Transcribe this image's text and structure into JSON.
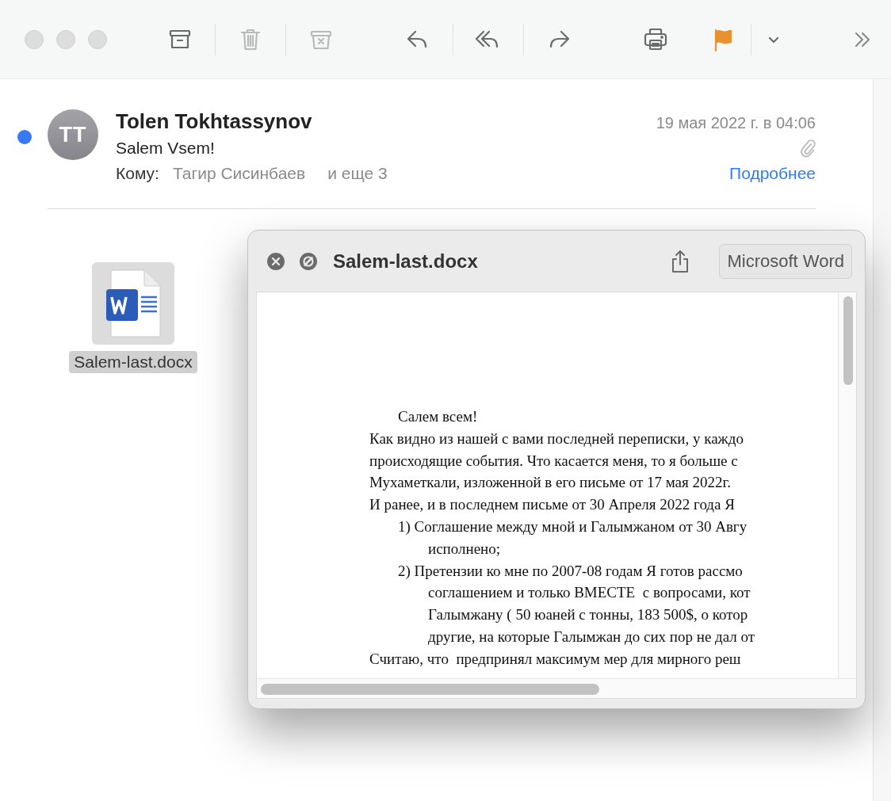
{
  "toolbar_groups": [
    {
      "items": [
        {
          "kind": "archive",
          "disabled": false
        }
      ]
    },
    {
      "items": [
        {
          "kind": "trash",
          "disabled": true
        }
      ]
    },
    {
      "items": [
        {
          "kind": "junk",
          "disabled": true
        },
        {
          "kind": "reply",
          "disabled": false
        }
      ]
    },
    {
      "items": [
        {
          "kind": "reply_all",
          "disabled": false
        }
      ]
    },
    {
      "items": [
        {
          "kind": "forward",
          "disabled": false
        },
        {
          "kind": "print",
          "disabled": false
        },
        {
          "kind": "flag",
          "disabled": false
        }
      ]
    },
    {
      "items": [
        {
          "kind": "menu",
          "disabled": false
        },
        {
          "kind": "more",
          "disabled": false
        }
      ]
    }
  ],
  "message": {
    "unread": true,
    "avatar_initials": "TT",
    "sender": "Tolen Tokhtassynov",
    "date": "19 мая 2022 г. в 04:06",
    "subject": "Salem Vsem!",
    "has_attachment": true,
    "to_label": "Кому:",
    "recipient": "Тагир Сисинбаев",
    "more_recipients": "и еще 3",
    "details_link": "Подробнее"
  },
  "attachment": {
    "name": "Salem-last.docx",
    "selected": true
  },
  "quicklook": {
    "title": "Salem-last.docx",
    "open_with": "Microsoft Word",
    "document_lines": [
      {
        "kind": "first",
        "text": "Салем всем!"
      },
      {
        "kind": "body",
        "text": "Как видно из нашей с вами последней переписки, у каждо"
      },
      {
        "kind": "body",
        "text": "происходящие события. Что касается меня, то я больше с"
      },
      {
        "kind": "body",
        "text": "Мухаметкали, изложенной в его письме от 17 мая 2022г."
      },
      {
        "kind": "body",
        "text": "И ранее, и в последнем письме от 30 Апреля 2022 года Я"
      },
      {
        "kind": "item",
        "text": "1) Соглашение между мной и Галымжаном от 30 Авгу"
      },
      {
        "kind": "cont",
        "text": "исполнено;"
      },
      {
        "kind": "item",
        "text": "2) Претензии ко мне по 2007-08 годам Я готов рассмо"
      },
      {
        "kind": "cont",
        "text": "соглашением и только ВМЕСТЕ  с вопросами, кот"
      },
      {
        "kind": "cont",
        "text": "Галымжану ( 50 юаней с тонны, 183 500$, о котор"
      },
      {
        "kind": "cont",
        "text": "другие, на которые Галымжан до сих пор не дал от"
      },
      {
        "kind": "body",
        "text": "Считаю, что  предпринял максимум мер для мирного реш"
      }
    ]
  }
}
